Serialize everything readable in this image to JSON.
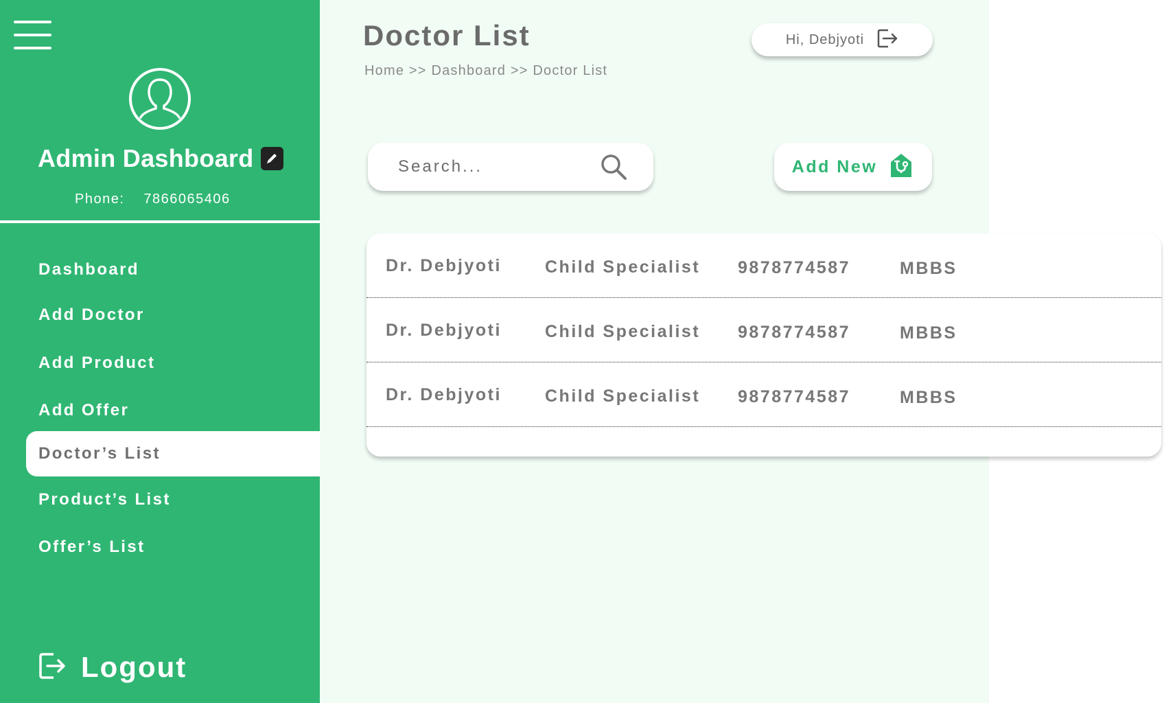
{
  "sidebar": {
    "profile": {
      "title": "Admin Dashboard",
      "phone_label": "Phone:",
      "phone_value": "7866065406"
    },
    "items": [
      {
        "label": "Dashboard",
        "active": false
      },
      {
        "label": "Add Doctor",
        "active": false
      },
      {
        "label": "Add Product",
        "active": false
      },
      {
        "label": "Add Offer",
        "active": false
      },
      {
        "label": "Doctor’s List",
        "active": true
      },
      {
        "label": "Product’s List",
        "active": false
      },
      {
        "label": "Offer’s List",
        "active": false
      }
    ],
    "logout_label": "Logout"
  },
  "header": {
    "title": "Doctor List",
    "breadcrumb": [
      "Home",
      "Dashboard",
      "Doctor List"
    ],
    "breadcrumb_separator": ">>",
    "greeting": "Hi, Debjyoti"
  },
  "search": {
    "placeholder": "Search...",
    "value": ""
  },
  "actions": {
    "add_new_label": "Add New"
  },
  "table": {
    "rows": [
      {
        "name": "Dr. Debjyoti",
        "specialty": "Child Specialist",
        "phone": "9878774587",
        "degree": "MBBS"
      },
      {
        "name": "Dr. Debjyoti",
        "specialty": "Child Specialist",
        "phone": "9878774587",
        "degree": "MBBS"
      },
      {
        "name": "Dr. Debjyoti",
        "specialty": "Child Specialist",
        "phone": "9878774587",
        "degree": "MBBS"
      }
    ]
  },
  "colors": {
    "brand_green": "#2fb673",
    "main_background": "#f1fcf5",
    "text_gray": "#6b6b6b"
  },
  "icons": {
    "menu": "hamburger-icon",
    "avatar": "user-icon",
    "edit": "pencil-icon",
    "logout": "logout-icon",
    "search": "search-icon",
    "add": "stethoscope-icon"
  }
}
